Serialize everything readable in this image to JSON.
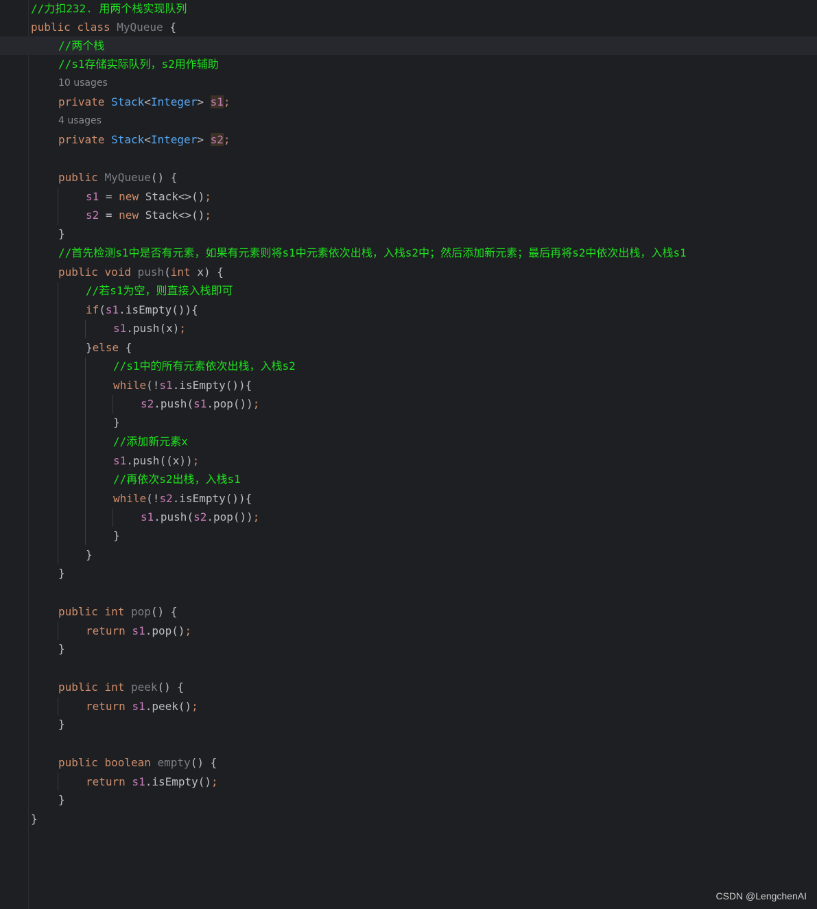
{
  "editor": {
    "lines": {
      "header_comment": "//力扣232. 用两个栈实现队列",
      "class_kw1": "public",
      "class_kw2": "class",
      "class_name": "MyQueue",
      "class_open": " {",
      "cmt_two_stacks": "//两个栈",
      "cmt_roles": "//s1存储实际队列，s2用作辅助",
      "hint_s1": "10 usages",
      "hint_s2": "4 usages",
      "field_kw": "private",
      "field_type": "Stack",
      "field_generic": "Integer",
      "field_s1": "s1",
      "field_s2": "s2",
      "ctor_name": "MyQueue",
      "new_kw": "new",
      "stack_ctor": "Stack<>()",
      "cmt_push_plan": "//首先检测s1中是否有元素，如果有元素则将s1中元素依次出栈，入栈s2中；然后添加新元素；最后再将s2中依次出栈，入栈s1",
      "void_kw": "void",
      "push_name": "push",
      "int_kw": "int",
      "param_x": "x",
      "cmt_if_empty": "//若s1为空，则直接入栈即可",
      "if_kw": "if",
      "else_kw": "else",
      "cmt_move_all": "//s1中的所有元素依次出栈，入栈s2",
      "while_kw": "while",
      "cmt_add_new": "//添加新元素x",
      "cmt_move_back": "//再依次s2出栈，入栈s1",
      "pop_name": "pop",
      "peek_name": "peek",
      "boolean_kw": "boolean",
      "empty_name": "empty",
      "return_kw": "return",
      "is_empty_call": "isEmpty",
      "push_call": "push",
      "pop_call": "pop",
      "peek_call": "peek"
    }
  },
  "watermark": "CSDN @LengchenAI",
  "colors": {
    "background": "#1e1f22",
    "keyword": "#cf8e6d",
    "type": "#56a8f5",
    "field": "#c77dbb",
    "comment": "#1fe01f",
    "text": "#bcbec4"
  }
}
